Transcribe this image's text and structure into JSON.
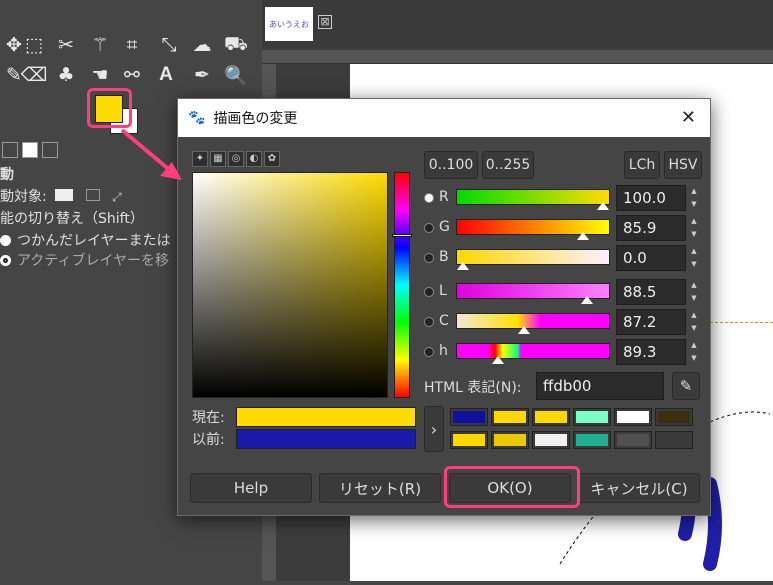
{
  "toolbox": {
    "tools_row1": [
      "move-tool-icon",
      "rect-select-icon",
      "scissors-icon",
      "fuzzy-select-icon",
      "crop-icon",
      "unified-transform-icon",
      "warp-icon",
      "bucket-fill-icon"
    ],
    "tools_row2": [
      "pencil-icon",
      "eraser-icon",
      "clone-icon",
      "smudge-icon",
      "path-icon",
      "text-tool-icon",
      "color-picker-icon",
      "zoom-icon"
    ],
    "fg_color": "#ffdb00",
    "bg_color": "#ffffff",
    "tool_name": "動",
    "target_label": "動対象:",
    "mode_label": "能の切り替え（Shift）",
    "option1": "つかんだレイヤーまたは",
    "option2": "アクティブレイヤーを移"
  },
  "canvas": {
    "tab_thumb_text": "あいうえお",
    "tab_close": "⊠"
  },
  "dialog": {
    "title": "描画色の変更",
    "close": "✕",
    "range_btn1": "0..100",
    "range_btn2": "0..255",
    "lch_btn": "LCh",
    "hsv_btn": "HSV",
    "sliders": [
      {
        "label": "R",
        "value": "100.0",
        "fraction": 1.0
      },
      {
        "label": "G",
        "value": "85.9",
        "fraction": 0.859
      },
      {
        "label": "B",
        "value": "0.0",
        "fraction": 0.0
      },
      {
        "label": "L",
        "value": "88.5",
        "fraction": 0.885
      },
      {
        "label": "C",
        "value": "87.2",
        "fraction": 0.436
      },
      {
        "label": "h",
        "value": "89.3",
        "fraction": 0.248
      }
    ],
    "html_label": "HTML 表記(N):",
    "html_value": "ffdb00",
    "current_label": "現在:",
    "previous_label": "以前:",
    "current_color": "#ffdb00",
    "previous_color": "#1a1aa8",
    "history_arrow": "›",
    "history_colors": [
      "#1010a0",
      "#ffd700",
      "#ffd700",
      "#7fffc8",
      "#ffffff",
      "#3a3010",
      "#ffd700",
      "#e8c800",
      "#f0f0f0",
      "#20b090",
      "#505050",
      "#3a3a3a"
    ],
    "buttons": {
      "help": "Help",
      "reset": "リセット(R)",
      "ok": "OK(O)",
      "cancel": "キャンセル(C)"
    }
  }
}
